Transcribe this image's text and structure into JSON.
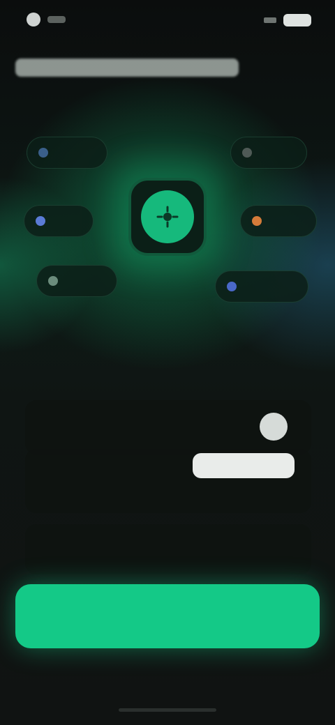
{
  "status_bar": {
    "time": "",
    "signal": "signal-icon",
    "battery": "battery-icon"
  },
  "header": {
    "title": ""
  },
  "hub": {
    "icon": "app-hub-icon",
    "accent_color": "#16b97c"
  },
  "chips": [
    {
      "id": "chip-tl",
      "label": "",
      "icon_color": "#3a5f8a"
    },
    {
      "id": "chip-tr",
      "label": "",
      "icon_color": "#4f5a56"
    },
    {
      "id": "chip-ml",
      "label": "",
      "icon_color": "#5b7bd6"
    },
    {
      "id": "chip-mr",
      "label": "",
      "icon_color": "#d47b3a"
    },
    {
      "id": "chip-bl",
      "label": "",
      "icon_color": "#6b8c7c"
    },
    {
      "id": "chip-br",
      "label": "",
      "icon_color": "#4a68c8"
    }
  ],
  "headline": {
    "part1": "",
    "accent": "",
    "part2": ""
  },
  "form": {
    "row1": {
      "label": "",
      "toggle_on": false
    },
    "row2": {
      "label": "",
      "sublabel": "",
      "input_value": "",
      "input_caption": ""
    },
    "row3": {
      "label": "",
      "value": ""
    }
  },
  "cta": {
    "label": ""
  },
  "colors": {
    "brand_green": "#14c987",
    "background": "#0c0f0e"
  }
}
